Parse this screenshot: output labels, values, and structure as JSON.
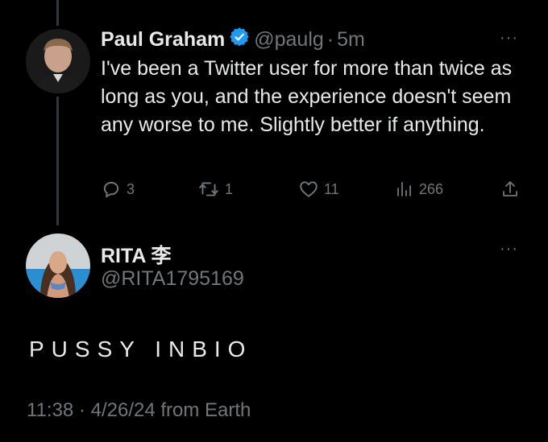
{
  "tweet1": {
    "name": "Paul Graham",
    "handle": "@paulg",
    "separator": "·",
    "time": "5m",
    "more_label": "···",
    "text": "I've been a Twitter user for more than twice as long as you, and the experience doesn't seem any worse to me. Slightly better if anything.",
    "replies": "3",
    "retweets": "1",
    "likes": "11",
    "views": "266",
    "icons": [
      "verified-badge-icon",
      "reply-icon",
      "retweet-icon",
      "like-icon",
      "views-icon",
      "share-icon"
    ]
  },
  "tweet2": {
    "name": "RITA 李",
    "handle": "@RITA1795169",
    "more_label": "···",
    "text": "PUSSY INBIO",
    "timestamp": "11:38 · 4/26/24 from Earth"
  },
  "colors": {
    "background": "#000000",
    "text": "#e7e9ea",
    "muted": "#71767b",
    "verified": "#1d9bf0",
    "thread_line": "#333639"
  }
}
